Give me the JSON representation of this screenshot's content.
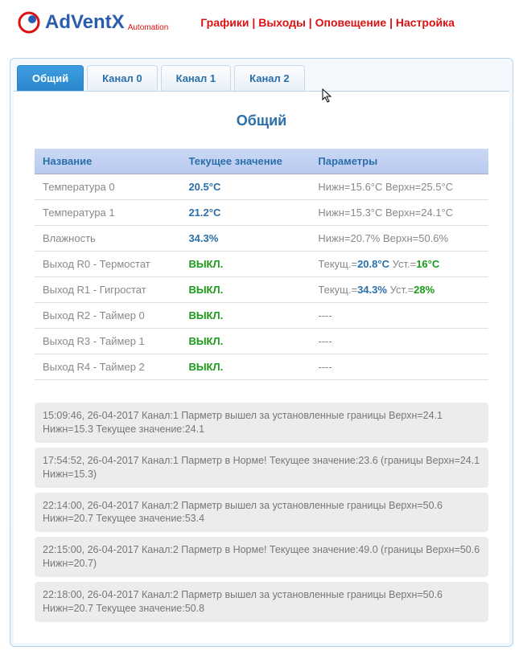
{
  "logo": {
    "brand": "AdVentX",
    "sub": "Automation"
  },
  "topnav": [
    "Графики",
    "Выходы",
    "Оповещение",
    "Настройка"
  ],
  "tabs": [
    "Общий",
    "Канал 0",
    "Канал 1",
    "Канал 2"
  ],
  "active_tab": 0,
  "page_title": "Общий",
  "headers": {
    "name": "Название",
    "value": "Текущее значение",
    "params": "Параметры"
  },
  "rows": [
    {
      "name": "Температура 0",
      "value": "20.5°C",
      "value_style": "blue",
      "param_html": "Нижн=15.6°C Верхн=25.5°C"
    },
    {
      "name": "Температура 1",
      "value": "21.2°C",
      "value_style": "blue",
      "param_html": "Нижн=15.3°C Верхн=24.1°C"
    },
    {
      "name": "Влажность",
      "value": "34.3%",
      "value_style": "blue",
      "param_html": "Нижн=20.7% Верхн=50.6%"
    },
    {
      "name": "Выход R0 - Термостат",
      "value": "ВЫКЛ.",
      "value_style": "green",
      "param_parts": [
        {
          "t": "Текущ.=",
          "c": ""
        },
        {
          "t": "20.8°C",
          "c": "blue"
        },
        {
          "t": " Уст.=",
          "c": ""
        },
        {
          "t": "16°C",
          "c": "green"
        }
      ]
    },
    {
      "name": "Выход R1 - Гигростат",
      "value": "ВЫКЛ.",
      "value_style": "green",
      "param_parts": [
        {
          "t": "Текущ.=",
          "c": ""
        },
        {
          "t": "34.3%",
          "c": "blue"
        },
        {
          "t": " Уст.=",
          "c": ""
        },
        {
          "t": "28%",
          "c": "green"
        }
      ]
    },
    {
      "name": "Выход R2 - Таймер 0",
      "value": "ВЫКЛ.",
      "value_style": "green",
      "param_html": "----"
    },
    {
      "name": "Выход R3 - Таймер 1",
      "value": "ВЫКЛ.",
      "value_style": "green",
      "param_html": "----"
    },
    {
      "name": "Выход R4 - Таймер 2",
      "value": "ВЫКЛ.",
      "value_style": "green",
      "param_html": "----"
    }
  ],
  "log": [
    "15:09:46, 26-04-2017    Канал:1 Парметр вышел за установленные границы Верхн=24.1 Нижн=15.3 Текущее значение:24.1",
    "17:54:52, 26-04-2017    Канал:1 Парметр в Норме! Текущее значение:23.6 (границы Верхн=24.1 Нижн=15.3)",
    "22:14:00, 26-04-2017    Канал:2 Парметр вышел за установленные границы Верхн=50.6 Нижн=20.7 Текущее значение:53.4",
    "22:15:00, 26-04-2017    Канал:2 Парметр в Норме! Текущее значение:49.0 (границы Верхн=50.6 Нижн=20.7)",
    "22:18:00, 26-04-2017    Канал:2 Парметр вышел за установленные границы Верхн=50.6 Нижн=20.7 Текущее значение:50.8"
  ]
}
